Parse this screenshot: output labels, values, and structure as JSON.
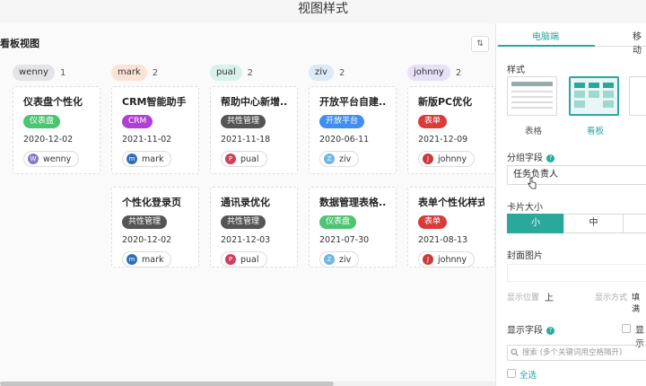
{
  "window": {
    "title": "视图样式"
  },
  "board": {
    "title": "看板视图",
    "sort_icon": "sort-icon",
    "columns": [
      {
        "name": "wenny",
        "count": "1",
        "pill_color": "#e3e3e8",
        "cards": [
          {
            "title": "仪表盘个性化",
            "tag": "仪表盘",
            "tag_color": "#4cc471",
            "date": "2020-12-02",
            "user": "wenny",
            "avatar": "W",
            "avatar_color": "#8a79c9"
          }
        ]
      },
      {
        "name": "mark",
        "count": "2",
        "pill_color": "#fbe2d6",
        "cards": [
          {
            "title": "CRM智能助手",
            "tag": "CRM",
            "tag_color": "#b03fd6",
            "date": "2021-11-02",
            "user": "mark",
            "avatar": "m",
            "avatar_color": "#2f6fb5"
          },
          {
            "title": "个性化登录页",
            "tag": "共性管理",
            "tag_color": "#555555",
            "date": "2020-12-02",
            "user": "mark",
            "avatar": "m",
            "avatar_color": "#2f6fb5"
          }
        ]
      },
      {
        "name": "pual",
        "count": "2",
        "pill_color": "#d7f1ec",
        "cards": [
          {
            "title": "帮助中心新增...",
            "tag": "共性管理",
            "tag_color": "#555555",
            "date": "2021-11-18",
            "user": "pual",
            "avatar": "P",
            "avatar_color": "#cf3e5a"
          },
          {
            "title": "通讯录优化",
            "tag": "共性管理",
            "tag_color": "#555555",
            "date": "2021-12-03",
            "user": "pual",
            "avatar": "P",
            "avatar_color": "#cf3e5a"
          }
        ]
      },
      {
        "name": "ziv",
        "count": "2",
        "pill_color": "#dbe9f8",
        "cards": [
          {
            "title": "开放平台自建...",
            "tag": "开放平台",
            "tag_color": "#3f8ef0",
            "date": "2020-06-11",
            "user": "ziv",
            "avatar": "Z",
            "avatar_color": "#6bb7e8"
          },
          {
            "title": "数据管理表格...",
            "tag": "仪表盘",
            "tag_color": "#4cc471",
            "date": "2021-07-30",
            "user": "ziv",
            "avatar": "Z",
            "avatar_color": "#6bb7e8"
          }
        ]
      },
      {
        "name": "johnny",
        "count": "2",
        "pill_color": "#e8e0f6",
        "cards": [
          {
            "title": "新版PC优化",
            "tag": "表单",
            "tag_color": "#d93a3a",
            "date": "2021-12-09",
            "user": "johnny",
            "avatar": "J",
            "avatar_color": "#c93a3a"
          },
          {
            "title": "表单个性化样式",
            "tag": "表单",
            "tag_color": "#d93a3a",
            "date": "2021-08-13",
            "user": "johnny",
            "avatar": "J",
            "avatar_color": "#c93a3a"
          }
        ]
      }
    ]
  },
  "panel": {
    "tabs": [
      "电脑端",
      "移动"
    ],
    "style_label": "样式",
    "style_options": [
      "表格",
      "看板"
    ],
    "group_field_label": "分组字段",
    "group_field_value": "任务负责人",
    "card_size_label": "卡片大小",
    "card_sizes": [
      "小",
      "中"
    ],
    "cover_label": "封面图片",
    "position_label": "显示位置",
    "position_value": "上",
    "mode_label": "显示方式",
    "mode_value": "填满",
    "display_fields_label": "显示字段",
    "display_toggle": "显示",
    "search_placeholder": "搜索 (多个关键词用空格隔开)",
    "select_all": "全选",
    "accent": "#2aa89b"
  }
}
